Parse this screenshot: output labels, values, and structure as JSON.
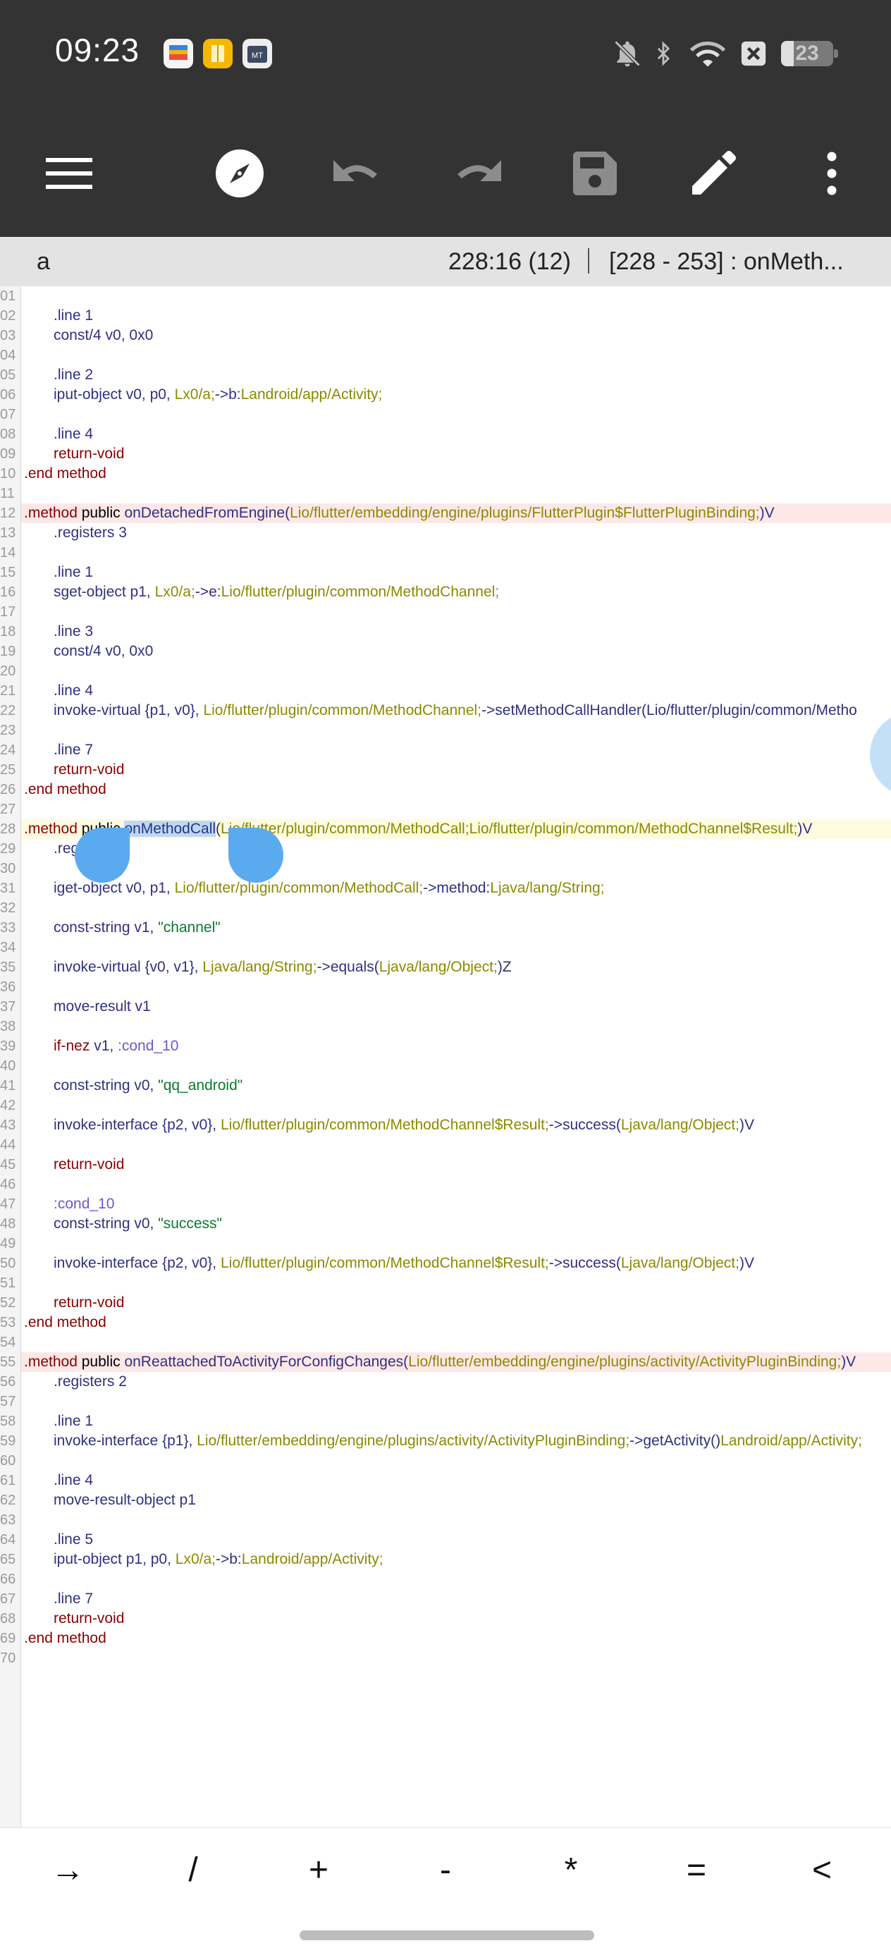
{
  "status_bar": {
    "time": "09:23",
    "battery_level": "23",
    "app_icons": [
      "wallet-app-icon",
      "notes-app-icon",
      "mt-manager-app-icon"
    ],
    "status_icons": [
      "bell-off-icon",
      "bluetooth-icon",
      "wifi-icon",
      "sim-off-icon",
      "battery-icon"
    ]
  },
  "toolbar": {
    "buttons": [
      "menu-icon",
      "compass-icon",
      "undo-icon",
      "redo-icon",
      "save-icon",
      "edit-icon",
      "more-vert-icon"
    ]
  },
  "info_bar": {
    "file_name": "a",
    "cursor_position": "228:16 (12)",
    "method_range": "[228 - 253] : onMeth..."
  },
  "code_lines": [
    {
      "num": "01",
      "text": ""
    },
    {
      "num": "02",
      "text": "    .line 1"
    },
    {
      "num": "03",
      "text": "    const/4 v0, 0x0"
    },
    {
      "num": "04",
      "text": ""
    },
    {
      "num": "05",
      "text": "    .line 2"
    },
    {
      "num": "06",
      "text": "    iput-object v0, p0, Lx0/a;->b:Landroid/app/Activity;"
    },
    {
      "num": "07",
      "text": ""
    },
    {
      "num": "08",
      "text": "    .line 4"
    },
    {
      "num": "09",
      "text": "    return-void"
    },
    {
      "num": "10",
      "text": ".end method"
    },
    {
      "num": "11",
      "text": ""
    },
    {
      "num": "12",
      "text": ".method public onDetachedFromEngine(Lio/flutter/embedding/engine/plugins/FlutterPlugin$FlutterPluginBinding;)V"
    },
    {
      "num": "13",
      "text": "    .registers 3"
    },
    {
      "num": "14",
      "text": ""
    },
    {
      "num": "15",
      "text": "    .line 1"
    },
    {
      "num": "16",
      "text": "    sget-object p1, Lx0/a;->e:Lio/flutter/plugin/common/MethodChannel;"
    },
    {
      "num": "17",
      "text": ""
    },
    {
      "num": "18",
      "text": "    .line 3"
    },
    {
      "num": "19",
      "text": "    const/4 v0, 0x0"
    },
    {
      "num": "20",
      "text": ""
    },
    {
      "num": "21",
      "text": "    .line 4"
    },
    {
      "num": "22",
      "text": "    invoke-virtual {p1, v0}, Lio/flutter/plugin/common/MethodChannel;->setMethodCallHandler(Lio/flutter/plugin/common/Metho"
    },
    {
      "num": "23",
      "text": ""
    },
    {
      "num": "24",
      "text": "    .line 7"
    },
    {
      "num": "25",
      "text": "    return-void"
    },
    {
      "num": "26",
      "text": ".end method"
    },
    {
      "num": "27",
      "text": ""
    },
    {
      "num": "28",
      "text": ".method public onMethodCall(Lio/flutter/plugin/common/MethodCall;Lio/flutter/plugin/common/MethodChannel$Result;)V"
    },
    {
      "num": "29",
      "text": "    .registers 5"
    },
    {
      "num": "30",
      "text": ""
    },
    {
      "num": "31",
      "text": "    iget-object v0, p1, Lio/flutter/plugin/common/MethodCall;->method:Ljava/lang/String;"
    },
    {
      "num": "32",
      "text": ""
    },
    {
      "num": "33",
      "text": "    const-string v1, \"channel\""
    },
    {
      "num": "34",
      "text": ""
    },
    {
      "num": "35",
      "text": "    invoke-virtual {v0, v1}, Ljava/lang/String;->equals(Ljava/lang/Object;)Z"
    },
    {
      "num": "36",
      "text": ""
    },
    {
      "num": "37",
      "text": "    move-result v1"
    },
    {
      "num": "38",
      "text": ""
    },
    {
      "num": "39",
      "text": "    if-nez v1, :cond_10"
    },
    {
      "num": "40",
      "text": ""
    },
    {
      "num": "41",
      "text": "    const-string v0, \"qq_android\""
    },
    {
      "num": "42",
      "text": ""
    },
    {
      "num": "43",
      "text": "    invoke-interface {p2, v0}, Lio/flutter/plugin/common/MethodChannel$Result;->success(Ljava/lang/Object;)V"
    },
    {
      "num": "44",
      "text": ""
    },
    {
      "num": "45",
      "text": "    return-void"
    },
    {
      "num": "46",
      "text": ""
    },
    {
      "num": "47",
      "text": "    :cond_10"
    },
    {
      "num": "48",
      "text": "    const-string v0, \"success\""
    },
    {
      "num": "49",
      "text": ""
    },
    {
      "num": "50",
      "text": "    invoke-interface {p2, v0}, Lio/flutter/plugin/common/MethodChannel$Result;->success(Ljava/lang/Object;)V"
    },
    {
      "num": "51",
      "text": ""
    },
    {
      "num": "52",
      "text": "    return-void"
    },
    {
      "num": "53",
      "text": ".end method"
    },
    {
      "num": "54",
      "text": ""
    },
    {
      "num": "55",
      "text": ".method public onReattachedToActivityForConfigChanges(Lio/flutter/embedding/engine/plugins/activity/ActivityPluginBinding;)V"
    },
    {
      "num": "56",
      "text": "    .registers 2"
    },
    {
      "num": "57",
      "text": ""
    },
    {
      "num": "58",
      "text": "    .line 1"
    },
    {
      "num": "59",
      "text": "    invoke-interface {p1}, Lio/flutter/embedding/engine/plugins/activity/ActivityPluginBinding;->getActivity()Landroid/app/Activity;"
    },
    {
      "num": "60",
      "text": ""
    },
    {
      "num": "61",
      "text": "    .line 4"
    },
    {
      "num": "62",
      "text": "    move-result-object p1"
    },
    {
      "num": "63",
      "text": ""
    },
    {
      "num": "64",
      "text": "    .line 5"
    },
    {
      "num": "65",
      "text": "    iput-object p1, p0, Lx0/a;->b:Landroid/app/Activity;"
    },
    {
      "num": "66",
      "text": ""
    },
    {
      "num": "67",
      "text": "    .line 7"
    },
    {
      "num": "68",
      "text": "    return-void"
    },
    {
      "num": "69",
      "text": ".end method"
    },
    {
      "num": "70",
      "text": ""
    }
  ],
  "selection": {
    "line": "28",
    "text": "onMethodCall"
  },
  "key_bar": {
    "keys": [
      "→",
      "/",
      "+",
      "-",
      "*",
      "=",
      "<"
    ]
  },
  "colors": {
    "bar_bg": "#333333",
    "info_bg": "#e3e3e3",
    "selection": "#bcd9f5",
    "handle": "#5aaaf0"
  }
}
